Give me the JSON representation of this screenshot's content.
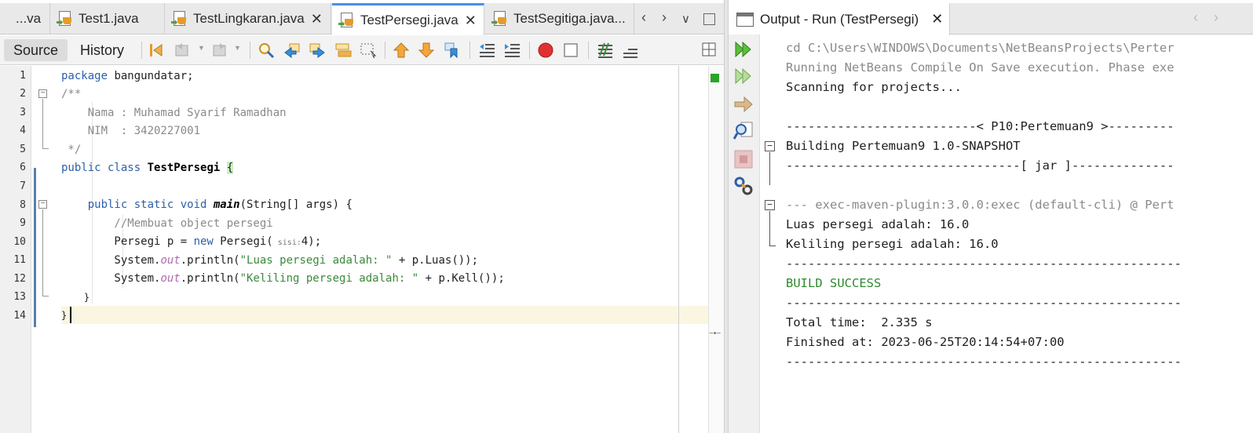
{
  "editor": {
    "tabs": [
      {
        "label": "...va",
        "active": false,
        "has_icon": false
      },
      {
        "label": "Test1.java",
        "active": false,
        "has_icon": true
      },
      {
        "label": "TestLingkaran.java",
        "active": false,
        "has_icon": true
      },
      {
        "label": "TestPersegi.java",
        "active": true,
        "has_icon": true
      },
      {
        "label": "TestSegitiga.java...",
        "active": false,
        "has_icon": true
      }
    ],
    "close_glyph": "✕",
    "toolbar": {
      "source_label": "Source",
      "history_label": "History"
    },
    "line_numbers": [
      "1",
      "2",
      "3",
      "4",
      "5",
      "6",
      "7",
      "8",
      "9",
      "10",
      "11",
      "12",
      "13",
      "14"
    ],
    "code": {
      "l1_kw": "package",
      "l1_rest": " bangundatar;",
      "l2": "/**",
      "l3": "    Nama : Muhamad Syarif Ramadhan",
      "l4": "    NIM  : 3420227001",
      "l5": " */",
      "l6_kw": "public class",
      "l6_cls": " TestPersegi",
      "l6_brace": "{",
      "l8_kw": "    public static void",
      "l8_mth": "main",
      "l8_rest": "(String[] args) {",
      "l9": "        //Membuat object persegi",
      "l10_a": "        Persegi p = ",
      "l10_kw": "new",
      "l10_b": " Persegi(",
      "l10_hint": " sisi:",
      "l10_c": "4);",
      "l11_a": "        System.",
      "l11_out": "out",
      "l11_b": ".println(",
      "l11_str": "\"Luas persegi adalah: \"",
      "l11_c": " + p.Luas());",
      "l12_a": "        System.",
      "l12_out": "out",
      "l12_b": ".println(",
      "l12_str": "\"Keliling persegi adalah: \"",
      "l12_c": " + p.Kell());",
      "l13": "    }",
      "l14": "}"
    }
  },
  "output": {
    "tab_label": "Output - Run (TestPersegi)",
    "close_glyph": "✕",
    "lines": {
      "cd": "cd C:\\Users\\WINDOWS\\Documents\\NetBeansProjects\\Perter",
      "running": "Running NetBeans Compile On Save execution. Phase exe",
      "scanning": "Scanning for projects...",
      "header": "--------------------------< P10:Pertemuan9 >---------",
      "building": "Building Pertemuan9 1.0-SNAPSHOT",
      "jar": "--------------------------------[ jar ]--------------",
      "exec": "--- exec-maven-plugin:3.0.0:exec (default-cli) @ Pert",
      "luas": "Luas persegi adalah: 16.0",
      "keliling": "Keliling persegi adalah: 16.0",
      "sep1": "------------------------------------------------------",
      "success": "BUILD SUCCESS",
      "sep2": "------------------------------------------------------",
      "total": "Total time:  2.335 s",
      "finished": "Finished at: 2023-06-25T20:14:54+07:00",
      "sep3": "------------------------------------------------------"
    }
  },
  "colors": {
    "keyword": "#2d5fa8",
    "comment": "#8a8a8a",
    "string": "#3b8a3b",
    "build_success": "#2f8a2f",
    "active_tab_accent": "#4a90e2"
  },
  "icons": [
    "java-file-icon",
    "back-icon",
    "forward-icon",
    "search-icon",
    "find-previous-icon",
    "find-next-icon",
    "toggle-highlight-icon",
    "select-rect-icon",
    "prev-bookmark-icon",
    "next-bookmark-icon",
    "toggle-bookmark-icon",
    "shift-left-icon",
    "shift-right-icon",
    "record-macro-icon",
    "stop-macro-icon",
    "comment-icon",
    "uncomment-icon",
    "split-icon",
    "rerun-icon",
    "rerun-with-params-icon",
    "continue-icon",
    "inspect-icon",
    "stop-icon",
    "settings-icon",
    "output-window-icon"
  ]
}
